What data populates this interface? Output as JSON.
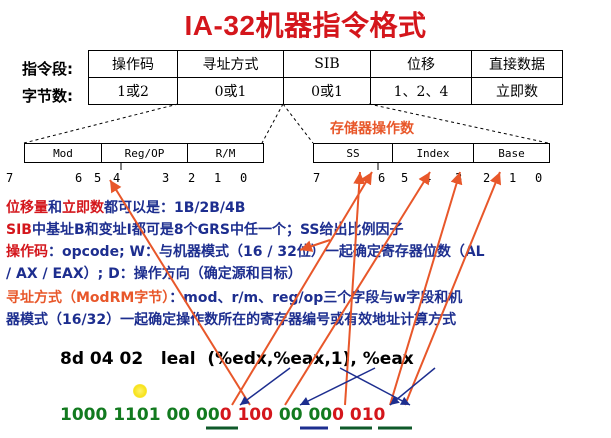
{
  "title": "IA-32机器指令格式",
  "row_labels": [
    "指令段:",
    "字节数:"
  ],
  "fields": [
    "操作码",
    "寻址方式",
    "SIB",
    "位移",
    "直接数据"
  ],
  "bytes": [
    "1或2",
    "0或1",
    "0或1",
    "1、2、4",
    "立即数"
  ],
  "memory_operand_label": "存储器操作数",
  "modrm": {
    "fields": [
      "Mod",
      "Reg/OP",
      "R/M"
    ],
    "bits": [
      "7",
      "6",
      "5",
      "4",
      "3",
      "2",
      "1",
      "0"
    ]
  },
  "sib": {
    "fields": [
      "SS",
      "Index",
      "Base"
    ],
    "bits": [
      "7",
      "6",
      "5",
      "4",
      "3",
      "2",
      "1",
      "0"
    ]
  },
  "notes": {
    "l1_a": "位移量",
    "l1_b": "和",
    "l1_c": "立即数",
    "l1_d": "都可以是：1B/2B/4B",
    "l2_a": "SIB",
    "l2_b": "中基址B和变址I都可是8个GRS中任一个；SS给出比例因子",
    "l3_a": "操作码",
    "l3_b": "：opcode; W：与机器模式（16 / 32位）一起确定寄存器位数（AL",
    "l4": "/ AX / EAX）; D：操作方向（确定源和目标）",
    "l5_a": "寻址方式（ModRM字节）",
    "l5_b": "：mod、r/m、reg/op三个字段与w字段和机",
    "l6": "器模式（16/32）一起确定操作数所在的寄存器编号或有效地址计算方式"
  },
  "asm": {
    "bytes": "8d 04 02",
    "instruction": "leal  (%edx,%eax,1), %eax"
  },
  "binary": {
    "p1": "1000 1101 ",
    "p2": "00 ",
    "p3": "00",
    "p4": "0 ",
    "p5": "100 ",
    "p6": "00 ",
    "p7": "00",
    "p8": "0 ",
    "p9": "010"
  },
  "colors": {
    "title": "#d4161c",
    "note_blue": "#1d2e8f",
    "arrow": "#e8572a",
    "green": "#127a1f",
    "underline_green": "#0f5a2a",
    "underline_navy": "#1d2e8f"
  }
}
